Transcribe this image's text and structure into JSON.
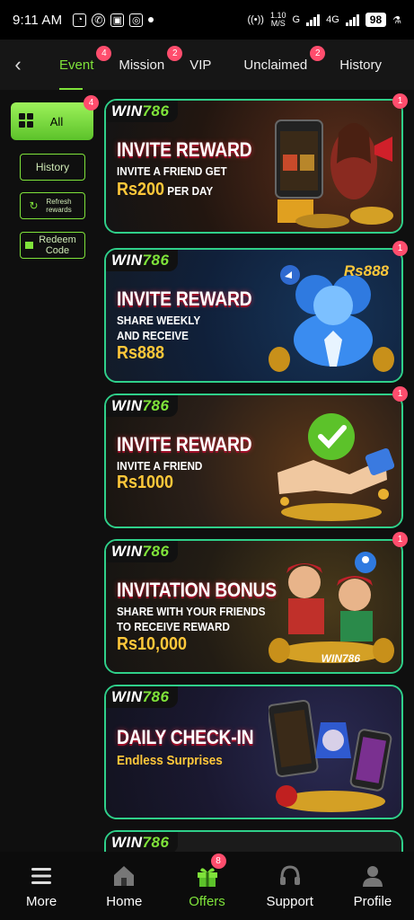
{
  "status_bar": {
    "time": "9:11 AM",
    "speed_top": "1.10",
    "speed_unit": "M/S",
    "signal_1": "G",
    "signal_2": "4G",
    "battery": "98"
  },
  "tabs": {
    "back_icon": "chevron-left-icon",
    "items": [
      {
        "label": "Event",
        "badge": "4"
      },
      {
        "label": "Mission",
        "badge": "2"
      },
      {
        "label": "VIP",
        "badge": ""
      },
      {
        "label": "Unclaimed",
        "badge": "2"
      },
      {
        "label": "History",
        "badge": ""
      }
    ]
  },
  "sidebar": {
    "all_label": "All",
    "all_badge": "4",
    "history_label": "History",
    "refresh_label": "Refresh rewards",
    "redeem_label": "Redeem Code"
  },
  "cards": [
    {
      "logo_a": "WIN",
      "logo_b": "786",
      "title": "INVITE REWARD",
      "sub1": "INVITE A FRIEND GET",
      "sub2": "",
      "amount": "Rs200",
      "amount_suffix": " PER DAY",
      "badge": "1"
    },
    {
      "logo_a": "WIN",
      "logo_b": "786",
      "title": "INVITE REWARD",
      "sub1": "SHARE WEEKLY",
      "sub2": "AND RECEIVE",
      "amount": "Rs888",
      "amount_suffix": "",
      "art_text": "Rs888",
      "badge": "1"
    },
    {
      "logo_a": "WIN",
      "logo_b": "786",
      "title": "INVITE REWARD",
      "sub1": "INVITE A FRIEND",
      "sub2": "",
      "amount": "Rs1000",
      "amount_suffix": "",
      "badge": "1"
    },
    {
      "logo_a": "WIN",
      "logo_b": "786",
      "title": "INVITATION BONUS",
      "sub1": "SHARE WITH YOUR FRIENDS",
      "sub2": "TO RECEIVE REWARD",
      "amount": "Rs10,000",
      "amount_suffix": "",
      "art_text": "WIN786",
      "badge": "1"
    },
    {
      "logo_a": "WIN",
      "logo_b": "786",
      "title": "DAILY CHECK-IN",
      "sub1": "Endless Surprises",
      "sub2": "",
      "amount": "",
      "amount_suffix": "",
      "badge": ""
    },
    {
      "logo_a": "WIN",
      "logo_b": "786"
    }
  ],
  "bottom_nav": [
    {
      "label": "More",
      "icon": "menu-icon"
    },
    {
      "label": "Home",
      "icon": "home-icon"
    },
    {
      "label": "Offers",
      "icon": "gift-icon",
      "badge": "8"
    },
    {
      "label": "Support",
      "icon": "headset-icon"
    },
    {
      "label": "Profile",
      "icon": "person-icon"
    }
  ],
  "colors": {
    "accent": "#7fe33a",
    "badge": "#ff4d6d",
    "card_border": "#2fd08a",
    "amount": "#ffc83a"
  }
}
